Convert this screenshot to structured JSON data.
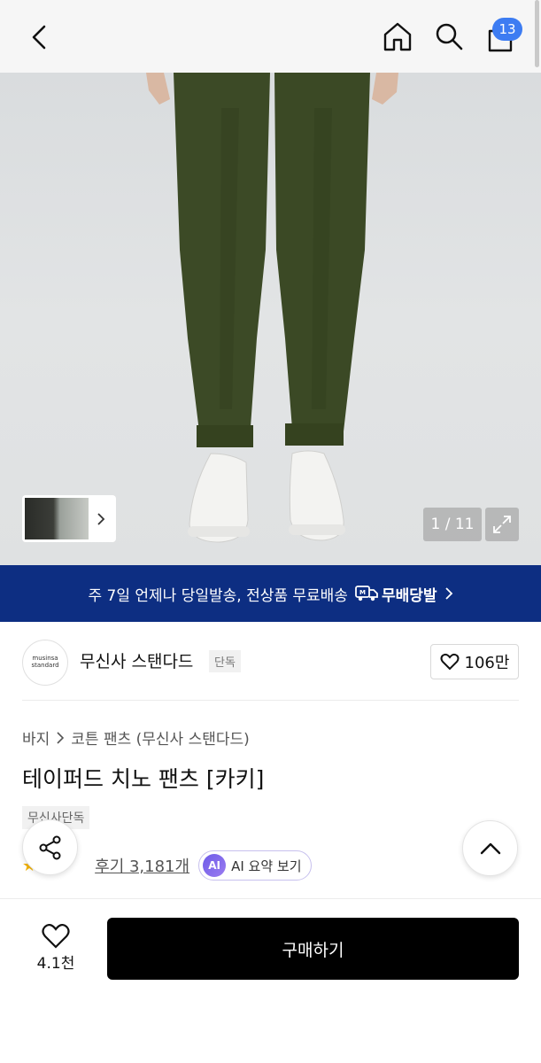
{
  "header": {
    "cart_count": "13",
    "icons": [
      "back-arrow-icon",
      "home-icon",
      "search-icon",
      "shopping-bag-icon"
    ]
  },
  "gallery": {
    "counter": "1 / 11"
  },
  "banner": {
    "text": "주 7일 언제나 당일발송, 전상품 무료배송",
    "service_name": "무배당발",
    "color": "#0d2e82"
  },
  "brand": {
    "logo_line1": "musinsa",
    "logo_line2": "standard",
    "name": "무신사 스탠다드",
    "tag": "단독",
    "likes": "106만"
  },
  "product": {
    "breadcrumb": [
      "바지",
      "코튼 팬츠 (무신사 스탠다드)"
    ],
    "title": "테이퍼드 치노 팬츠 [카키]",
    "exclusive_tag": "무신사단독",
    "reviews": "후기 3,181개",
    "ai_badge": "AI",
    "ai_summary": "AI 요약 보기"
  },
  "bottom": {
    "wish_count": "4.1천",
    "buy_label": "구매하기"
  }
}
